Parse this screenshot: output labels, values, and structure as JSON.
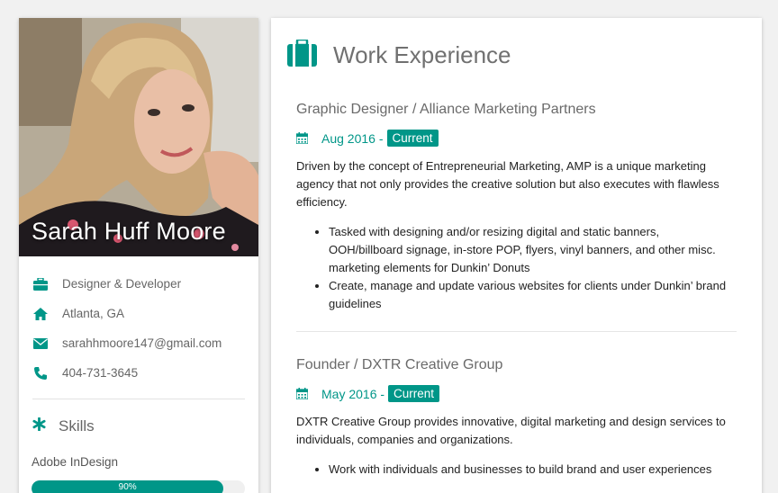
{
  "profile": {
    "name": "Sarah Huff Moore",
    "role": "Designer & Developer",
    "location": "Atlanta, GA",
    "email": "sarahhmoore147@gmail.com",
    "phone": "404-731-3645"
  },
  "skills": {
    "title": "Skills",
    "items": [
      {
        "name": "Adobe InDesign",
        "percent_label": "90%",
        "level": 0.9
      }
    ]
  },
  "work": {
    "title": "Work Experience",
    "jobs": [
      {
        "title": "Graphic Designer / Alliance Marketing Partners",
        "date": "Aug 2016 -",
        "badge": "Current",
        "description": "Driven by the concept of Entrepreneurial Marketing, AMP is a unique marketing agency that not only provides the creative solution but also executes with flawless efficiency.",
        "bullets": [
          "Tasked with designing and/or resizing digital and static banners, OOH/billboard signage, in-store POP, flyers, vinyl banners, and other misc. marketing elements for Dunkin’ Donuts",
          "Create, manage and update various websites for clients under Dunkin’ brand guidelines"
        ]
      },
      {
        "title": "Founder / DXTR Creative Group",
        "date": "May 2016 -",
        "badge": "Current",
        "description": "DXTR Creative Group provides innovative, digital marketing and design services to individuals, companies and organizations.",
        "bullets": [
          "Work with individuals and businesses to build brand and user experiences"
        ]
      }
    ]
  },
  "colors": {
    "accent": "#009688",
    "text_muted": "#666666",
    "background": "#f1f1f1"
  },
  "icons": {
    "role": "briefcase-icon",
    "location": "home-icon",
    "email": "envelope-icon",
    "phone": "phone-icon",
    "skills": "asterisk-icon",
    "section": "suitcase-icon",
    "date": "calendar-icon"
  }
}
